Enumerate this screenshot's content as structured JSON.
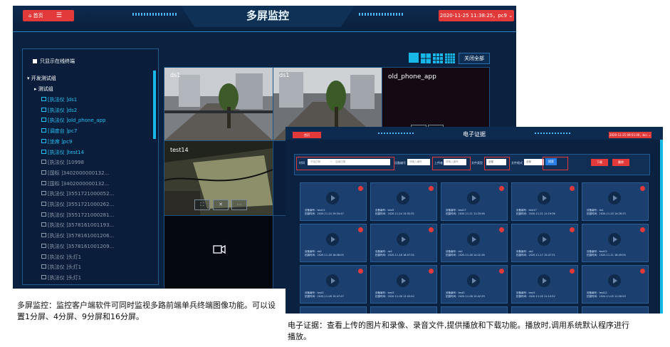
{
  "multi_screen": {
    "title": "多屏监控",
    "home_label": "首页",
    "menu_glyph": "☰",
    "datetime": "2020-11-25 11:38:25，pc9 ⌄",
    "online_only_label": "只显示在线终端",
    "tree": {
      "root": "▾ 开发测试组",
      "sub": "▸ 测试组",
      "items": [
        {
          "label": "[执法仪 ]ds1",
          "active": true
        },
        {
          "label": "[执法仪 ]ds2",
          "active": true
        },
        {
          "label": "[执法仪 ]old_phone_app",
          "active": true
        },
        {
          "label": "[调度台 ]pc7",
          "active": true
        },
        {
          "label": "[坐席 ]pc9",
          "active": true
        },
        {
          "label": "[执法仪 ]test14",
          "active": true
        },
        {
          "label": "[执法仪 ]10998",
          "active": false
        },
        {
          "label": "[国标 ]3402000000132...",
          "active": false
        },
        {
          "label": "[国标 ]3402000000132...",
          "active": false
        },
        {
          "label": "[执法仪 ]3551721000052...",
          "active": false
        },
        {
          "label": "[执法仪 ]3551721000262...",
          "active": false
        },
        {
          "label": "[执法仪 ]3551721000281...",
          "active": false
        },
        {
          "label": "[执法仪 ]3578161001193...",
          "active": false
        },
        {
          "label": "[执法仪 ]3578161001206...",
          "active": false
        },
        {
          "label": "[执法仪 ]3578161001209...",
          "active": false
        },
        {
          "label": "[执法仪 ]头灯1",
          "active": false
        },
        {
          "label": "[执法仪 ]头灯1",
          "active": false
        },
        {
          "label": "[执法仪 ]头灯1",
          "active": false
        }
      ]
    },
    "close_all_label": "关闭全部",
    "cells": {
      "c1": "ds1",
      "c2": "ds1",
      "c3": "old_phone_app",
      "c4": "test14"
    },
    "controls": {
      "fullscreen": "⛶",
      "close": "✕",
      "more": "⋯"
    },
    "camera_icon": "camera-icon"
  },
  "evidence": {
    "title": "电子证据",
    "home_label": "首页",
    "datetime": "2020-11-25 09:51:00，bcc ⌄",
    "filters": {
      "time_label": "时间",
      "start_placeholder": "开始日期",
      "sep": "→",
      "end_placeholder": "结束日期",
      "device_label": "设备编号",
      "device_placeholder": "请输入编号",
      "uploader_label": "上传者",
      "uploader_placeholder": "请输入编号",
      "type_label": "文件类型",
      "type_value": "全部",
      "type2_label": "文件格式",
      "type2_value": "全部",
      "search_label": "搜索"
    },
    "download_label": "下载",
    "delete_label": "删除",
    "tiles": [
      {
        "dev": "设备编号：test11",
        "time": "拍摄时间：2020-11-24 19:34:47"
      },
      {
        "dev": "设备编号：test5",
        "time": "拍摄时间：2020-11-24 15:52:32"
      },
      {
        "dev": "设备编号：test17",
        "time": "拍摄时间：2020-11-21 11:20:56"
      },
      {
        "dev": "设备编号：test17",
        "time": "拍摄时间：2020-11-21 11:19:36"
      },
      {
        "dev": "设备编号：ds1",
        "time": "拍摄时间：2020-11-20 14:26:23"
      },
      {
        "dev": "设备编号：ds2",
        "time": "拍摄时间：2020-11-18 18:08:05"
      },
      {
        "dev": "设备编号：ds2",
        "time": "拍摄时间：2020-11-18 18:07:34"
      },
      {
        "dev": "设备编号：ds2",
        "time": "拍摄时间：2020-11-18 14:21:26"
      },
      {
        "dev": "设备编号：ds2",
        "time": "拍摄时间：2020-11-17 15:47:31"
      },
      {
        "dev": "设备编号：test12",
        "time": "拍摄时间：2020-11-11 16:49:04"
      },
      {
        "dev": "设备编号：test3",
        "time": "拍摄时间：2020-11-06 15:47:07"
      },
      {
        "dev": "设备编号：test3",
        "time": "拍摄时间：2020-11-06 13:43:52"
      },
      {
        "dev": "设备编号：test3",
        "time": "拍摄时间：2020-11-06 13:42:29"
      },
      {
        "dev": "设备编号：test3",
        "time": "拍摄时间：2020-11-05 11:10:52"
      },
      {
        "dev": "设备编号：test12",
        "time": "拍摄时间：2020-11-05 11:00:03"
      }
    ]
  },
  "captions": {
    "multi_screen": "多屏监控：监控客户端软件可同时监视多路前端单兵终端图像功能。可以设置1分屏、4分屏、9分屏和16分屏。",
    "evidence": "电子证据：查看上传的图片和录像、录音文件,提供播放和下载功能。播放时,调用系统默认程序进行播放。"
  },
  "colors": {
    "panel": "#0b2140",
    "accent_red": "#e23a3a",
    "accent_cyan": "#17b7e8"
  }
}
